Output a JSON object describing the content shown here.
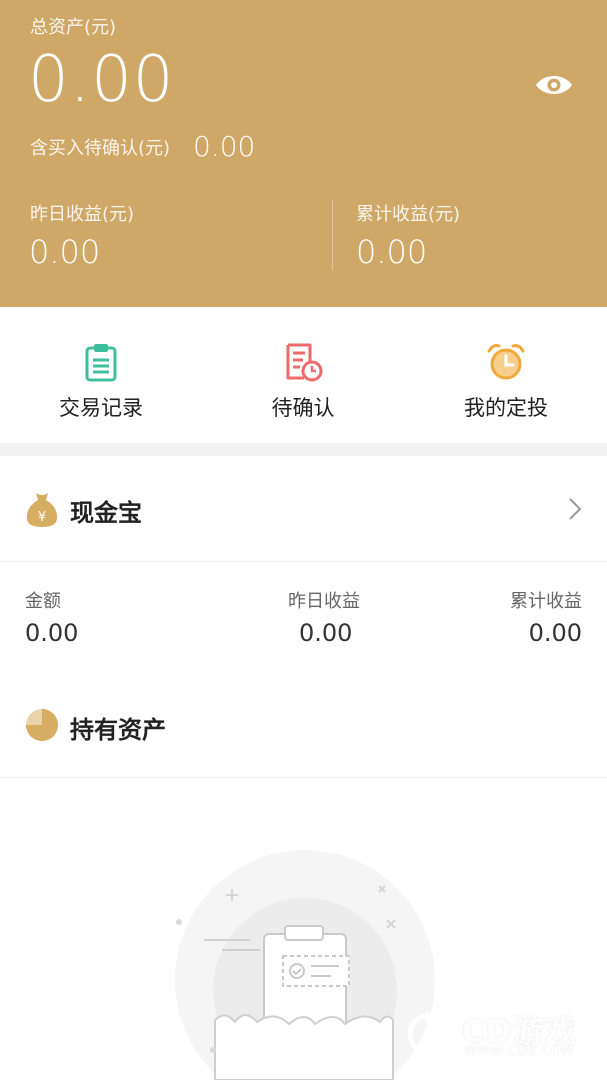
{
  "header": {
    "total_assets_label": "总资产(元)",
    "total_assets_value": "0.00",
    "pending_label": "含买入待确认(元)",
    "pending_value": "0.00",
    "yesterday_label": "昨日收益(元)",
    "yesterday_value": "0.00",
    "cumulative_label": "累计收益(元)",
    "cumulative_value": "0.00"
  },
  "quick_actions": [
    {
      "label": "交易记录",
      "icon": "clipboard-icon"
    },
    {
      "label": "待确认",
      "icon": "pending-document-icon"
    },
    {
      "label": "我的定投",
      "icon": "alarm-clock-icon"
    }
  ],
  "cash_treasure": {
    "title": "现金宝",
    "amount_label": "金额",
    "amount_value": "0.00",
    "yesterday_label": "昨日收益",
    "yesterday_value": "0.00",
    "cumulative_label": "累计收益",
    "cumulative_value": "0.00"
  },
  "holdings": {
    "title": "持有资产"
  },
  "watermark": {
    "brand": "CD游戏",
    "url": "WWW.CDB.COM"
  },
  "colors": {
    "header_bg": "#cfa868",
    "gold_icon": "#d7ac63",
    "teal_icon": "#3dbf9d",
    "red_icon": "#ee6b6b",
    "orange_icon": "#f2a93c"
  }
}
